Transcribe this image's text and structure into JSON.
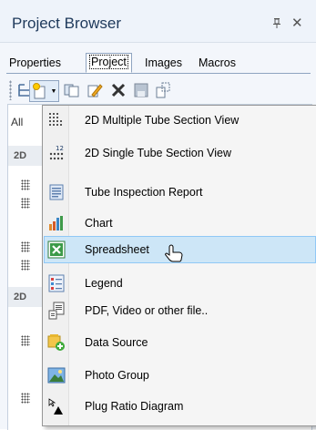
{
  "panel": {
    "title": "Project Browser",
    "pin_glyph": "▕",
    "close_glyph": "✕"
  },
  "tabs": [
    {
      "label": "Properties"
    },
    {
      "label": "Project",
      "active": true
    },
    {
      "label": "Images"
    },
    {
      "label": "Macros"
    }
  ],
  "toolbar": {
    "icons": [
      "tree-view-icon",
      "new-item-icon",
      "copy-icon",
      "edit-icon",
      "delete-icon",
      "save-icon",
      "paste-icon"
    ]
  },
  "background": {
    "filter_label": "All",
    "group1_label": "2D",
    "group2_label": "2D"
  },
  "menu": {
    "items": [
      {
        "label": "2D Multiple Tube Section View",
        "icon": "multi-tube-section-icon"
      },
      {
        "label": "2D Single Tube Section View",
        "icon": "single-tube-section-icon"
      },
      {
        "label": "Tube Inspection Report",
        "icon": "report-icon"
      },
      {
        "label": "Chart",
        "icon": "bar-chart-icon"
      },
      {
        "label": "Spreadsheet",
        "icon": "spreadsheet-icon",
        "highlighted": true
      },
      {
        "label": "Legend",
        "icon": "legend-icon"
      },
      {
        "label": "PDF, Video or other file..",
        "icon": "file-icon"
      },
      {
        "label": "Data Source",
        "icon": "data-source-icon"
      },
      {
        "label": "Photo Group",
        "icon": "photo-group-icon"
      },
      {
        "label": "Plug Ratio Diagram",
        "icon": "plug-ratio-icon"
      }
    ]
  },
  "colors": {
    "title": "#1e395b",
    "highlight_bg": "#cde6f7",
    "highlight_border": "#90c8f6"
  }
}
